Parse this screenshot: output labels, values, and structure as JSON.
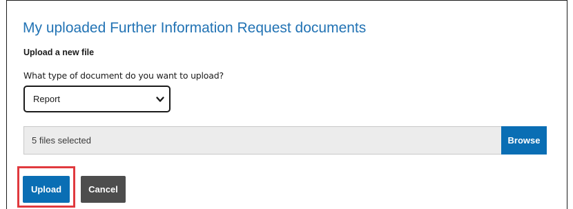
{
  "section": {
    "title": "My uploaded Further Information Request documents",
    "subheading": "Upload a new file"
  },
  "document_type": {
    "question": "What type of document do you want to upload?",
    "selected_value": "Report"
  },
  "file_picker": {
    "status": "5 files selected",
    "browse_label": "Browse"
  },
  "actions": {
    "upload_label": "Upload",
    "cancel_label": "Cancel"
  },
  "colors": {
    "title": "#2273b4",
    "primary_button": "#0a6eb4",
    "secondary_button": "#4d4d4d",
    "highlight": "#e0393e",
    "file_field_bg": "#ececec"
  },
  "icons": {
    "select_chevron": "chevron-down-icon"
  }
}
